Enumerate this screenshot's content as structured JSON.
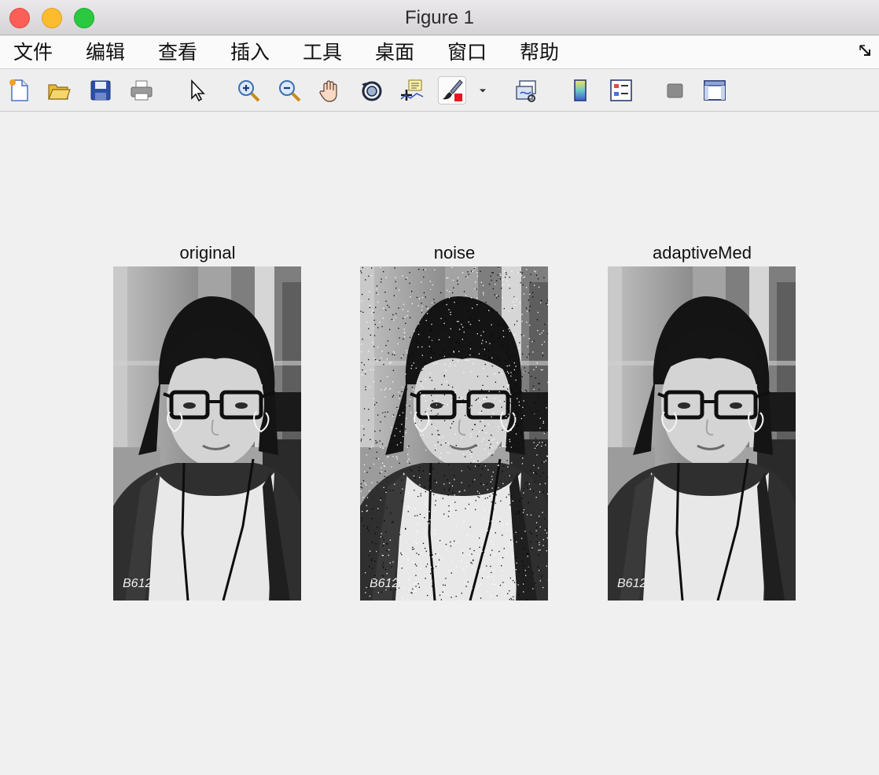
{
  "window": {
    "title": "Figure 1"
  },
  "menu": {
    "items": [
      "文件",
      "编辑",
      "查看",
      "插入",
      "工具",
      "桌面",
      "窗口",
      "帮助"
    ]
  },
  "toolbar": {
    "tools": [
      "new-figure-icon",
      "open-file-icon",
      "save-icon",
      "print-icon",
      "edit-plot-pointer-icon",
      "zoom-in-icon",
      "zoom-out-icon",
      "pan-hand-icon",
      "rotate-3d-icon",
      "data-cursor-icon",
      "brush-icon",
      "brush-dropdown-icon",
      "link-plot-icon",
      "colorbar-icon",
      "legend-icon",
      "hide-plot-tools-icon",
      "show-plot-tools-icon"
    ]
  },
  "axes": [
    {
      "title": "original",
      "content": "grayscale portrait photo"
    },
    {
      "title": "noise",
      "content": "grayscale portrait photo with salt-and-pepper noise"
    },
    {
      "title": "adaptiveMed",
      "content": "grayscale portrait photo after adaptive median filtering"
    }
  ],
  "watermark": "B612",
  "colors": {
    "brush_accent": "#e8141e",
    "figure_bg": "#f0f0f0"
  }
}
